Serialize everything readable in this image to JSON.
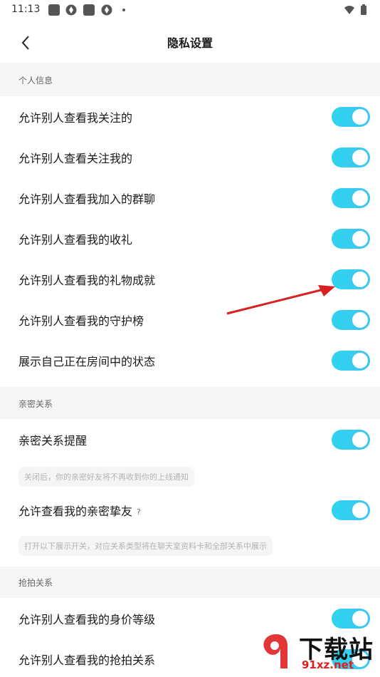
{
  "status_bar": {
    "time": "11:13"
  },
  "header": {
    "title": "隐私设置"
  },
  "sections": {
    "personal": {
      "title": "个人信息",
      "items": [
        {
          "label": "允许别人查看我关注的",
          "enabled": true
        },
        {
          "label": "允许别人查看关注我的",
          "enabled": true
        },
        {
          "label": "允许别人查看我加入的群聊",
          "enabled": true
        },
        {
          "label": "允许别人查看我的收礼",
          "enabled": true
        },
        {
          "label": "允许别人查看我的礼物成就",
          "enabled": true
        },
        {
          "label": "允许别人查看我的守护榜",
          "enabled": true
        },
        {
          "label": "展示自己正在房间中的状态",
          "enabled": true
        }
      ]
    },
    "intimate": {
      "title": "亲密关系",
      "items": [
        {
          "label": "亲密关系提醒",
          "enabled": true
        },
        {
          "label": "允许查看我的亲密挚友",
          "enabled": true,
          "help": "?"
        }
      ],
      "hints": [
        "关闭后，你的亲密好友将不再收到你的上线通知",
        "打开以下展示开关，对应关系类型将在聊天室资料卡和全部关系中展示"
      ]
    },
    "grab": {
      "title": "抢拍关系",
      "items": [
        {
          "label": "允许别人查看我的身价等级",
          "enabled": true
        },
        {
          "label": "允许别人查看我的抢拍关系",
          "enabled": true
        }
      ]
    }
  },
  "watermark": {
    "line1": "下载站",
    "line2": "91xz.net"
  },
  "colors": {
    "toggle_on": "#33cfef",
    "section_bg": "#f5f6f7",
    "arrow": "#d92020"
  }
}
